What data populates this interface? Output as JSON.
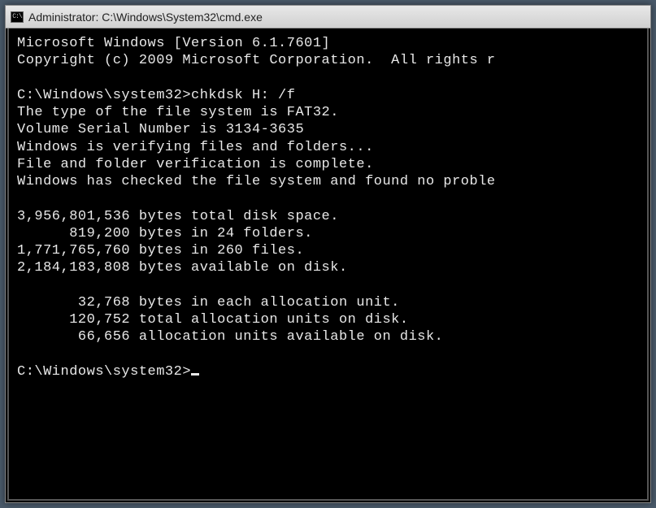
{
  "titlebar": {
    "icon_label": "C:\\",
    "title": "Administrator: C:\\Windows\\System32\\cmd.exe"
  },
  "terminal": {
    "line1": "Microsoft Windows [Version 6.1.7601]",
    "line2": "Copyright (c) 2009 Microsoft Corporation.  All rights r",
    "blank1": "",
    "line3": "C:\\Windows\\system32>chkdsk H: /f",
    "line4": "The type of the file system is FAT32.",
    "line5": "Volume Serial Number is 3134-3635",
    "line6": "Windows is verifying files and folders...",
    "line7": "File and folder verification is complete.",
    "line8": "Windows has checked the file system and found no proble",
    "blank2": "",
    "line9": "3,956,801,536 bytes total disk space.",
    "line10": "      819,200 bytes in 24 folders.",
    "line11": "1,771,765,760 bytes in 260 files.",
    "line12": "2,184,183,808 bytes available on disk.",
    "blank3": "",
    "line13": "       32,768 bytes in each allocation unit.",
    "line14": "      120,752 total allocation units on disk.",
    "line15": "       66,656 allocation units available on disk.",
    "blank4": "",
    "prompt": "C:\\Windows\\system32>"
  }
}
